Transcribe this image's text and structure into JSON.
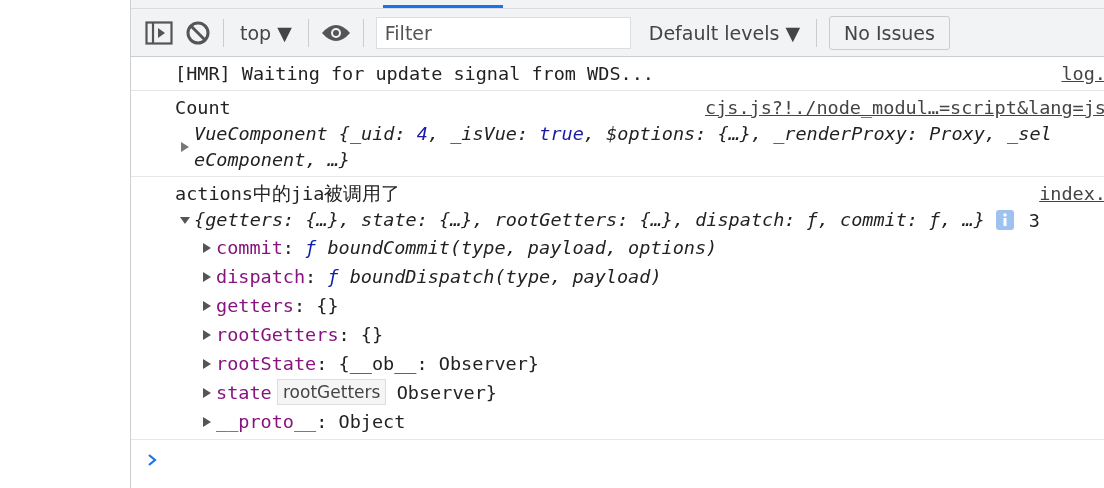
{
  "toolbar": {
    "context": "top ▼",
    "filter": {
      "placeholder": "Filter"
    },
    "levels": "Default levels ▼",
    "issues": "No Issues"
  },
  "messages": [
    {
      "kind": "text",
      "text": "[HMR] Waiting for update signal from WDS...",
      "source": "log."
    },
    {
      "kind": "object",
      "text": "Count",
      "source": "cjs.js?!./node_modul…=script&lang=js",
      "expanded": false,
      "lines": [
        [
          {
            "kind": "plain",
            "text": "VueComponent {_uid: "
          },
          {
            "kind": "number",
            "text": "4"
          },
          {
            "kind": "plain",
            "text": ", _isVue: "
          },
          {
            "kind": "number",
            "text": "true"
          },
          {
            "kind": "plain",
            "text": ", $options: {…}, _renderProxy: Proxy, _sel"
          }
        ],
        [
          {
            "kind": "plain",
            "text": "eComponent, …}"
          }
        ]
      ]
    },
    {
      "kind": "object",
      "text": "actions中的jia被调用了",
      "source": "index.",
      "expanded": true,
      "lines": [
        [
          {
            "kind": "plain",
            "text": "{getters: {…}, state: {…}, rootGetters: {…}, dispatch: ƒ, commit: ƒ, …}"
          }
        ]
      ],
      "count": "3",
      "properties": [
        {
          "key": "commit",
          "value": [
            {
              "kind": "plain",
              "text": ": "
            },
            {
              "kind": "func",
              "text": "ƒ"
            },
            {
              "kind": "italic",
              "text": " boundCommit(type, payload, options)"
            }
          ]
        },
        {
          "key": "dispatch",
          "value": [
            {
              "kind": "plain",
              "text": ": "
            },
            {
              "kind": "func",
              "text": "ƒ"
            },
            {
              "kind": "italic",
              "text": " boundDispatch(type, payload)"
            }
          ]
        },
        {
          "key": "getters",
          "value": [
            {
              "kind": "plain",
              "text": ": {}"
            }
          ]
        },
        {
          "key": "rootGetters",
          "value": [
            {
              "kind": "plain",
              "text": ": {}"
            }
          ]
        },
        {
          "key": "rootState",
          "value": [
            {
              "kind": "plain",
              "text": ": {__ob__: Observer}"
            }
          ]
        },
        {
          "key": "state",
          "value": [
            {
              "kind": "covered",
              "text": "Observer}"
            }
          ]
        },
        {
          "key": "__proto__",
          "value": [
            {
              "kind": "plain",
              "text": ": Object"
            }
          ]
        }
      ]
    }
  ],
  "tooltip": "rootGetters"
}
